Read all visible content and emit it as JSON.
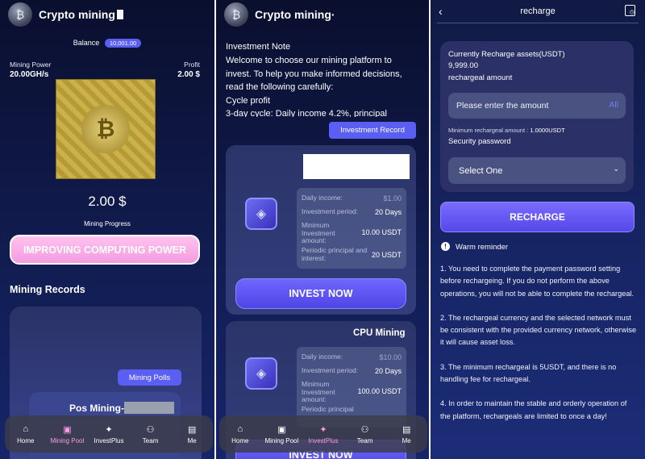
{
  "mining_screen": {
    "app_title": "Crypto mining",
    "balance_label": "Balance",
    "balance_value": "10,001.00",
    "mining_power_label": "Mining Power",
    "mining_power_value": "20.00GH/s",
    "profit_label": "Profit",
    "profit_value": "2.00 $",
    "amount": "2.00 $",
    "progress_label": "Mining Progress",
    "improve_button": "IMPROVING COMPUTING POWER",
    "records_title": "Mining Records",
    "polls_button": "Mining Polls",
    "pos_title": "Pos Mining-"
  },
  "invest_screen": {
    "app_title": "Crypto mining·",
    "note_title": "Investment Note",
    "note_lines": [
      "Welcome to choose our mining platform to",
      "invest. To help you make informed decisions,",
      "read the following carefully:",
      "Cycle profit",
      "3-day cycle: Daily income 4.2%, principal"
    ],
    "record_button": "Investment Record",
    "product1": {
      "daily_income_label": "Daily income:",
      "daily_income": "$1.00",
      "period_label": "Investment period:",
      "period": "20 Days",
      "min_label": "Minimum Investment amount:",
      "min_amount": "10.00 USDT",
      "periodic_label": "Periodic principal and interest:",
      "periodic": "20 USDT",
      "invest_button": "INVEST NOW"
    },
    "product2": {
      "name": "CPU Mining",
      "daily_income_label": "Daily income:",
      "daily_income": "$10.00",
      "period_label": "Investment period:",
      "period": "20 Days",
      "min_label": "Minimum Investment amount:",
      "min_amount": "100.00 USDT",
      "periodic_label": "Periodic principal",
      "invest_button": "INVEST NOW"
    }
  },
  "tabs": {
    "home": "Home",
    "mining_pool": "Mining Pool",
    "invest_plus": "InvestPlus",
    "team": "Team",
    "me": "Me"
  },
  "recharge_screen": {
    "title": "recharge",
    "assets_label": "Currently Recharge assets(USDT)",
    "assets_value": "9,999.00",
    "amount_label": "rechargeal amount",
    "amount_placeholder": "Please enter the amount",
    "all_link": "All",
    "min_label": "Minimum rechargeal amount :",
    "min_value": "1.0000USDT",
    "password_label": "Security password",
    "select_value": "Select One",
    "recharge_button": "RECHARGE",
    "warn_title": "Warm reminder",
    "rules": [
      "1. You need to complete the payment password setting before rechargeing. If you do not perform the above operations, you will not be able to complete the rechargeal.",
      "2. The rechargeal currency and the selected network must be consistent with the provided currency network, otherwise it will cause asset loss.",
      "3. The minimum rechargeal is 5USDT, and there is no handling fee for rechargeal.",
      "4. In order to maintain the stable and orderly operation of the platform, rechargeals are limited to once a day!"
    ]
  }
}
